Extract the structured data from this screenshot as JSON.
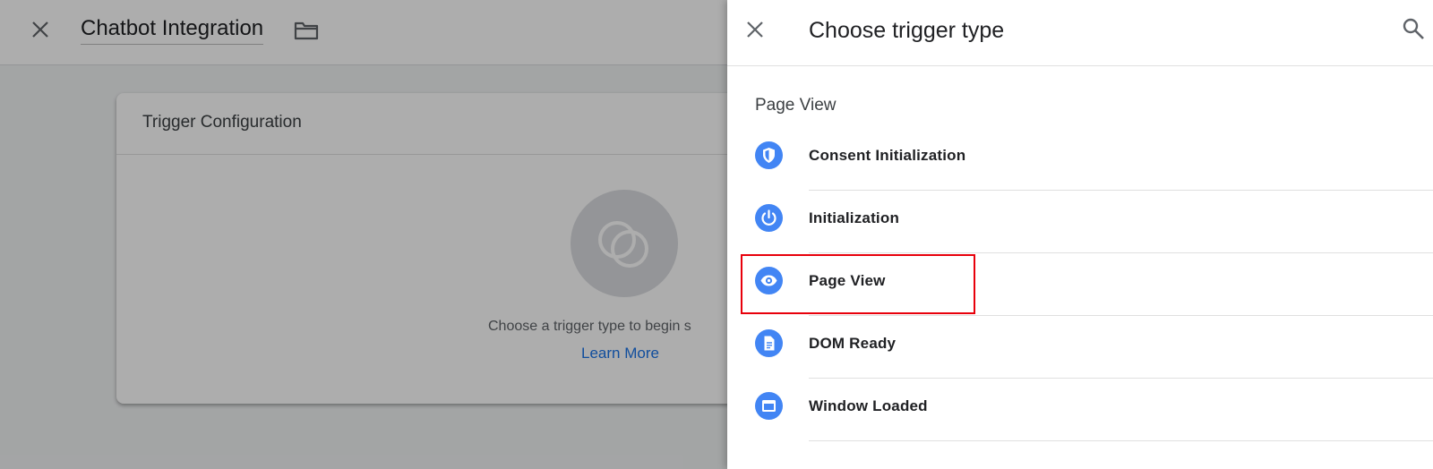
{
  "editor": {
    "title": "Chatbot Integration",
    "card_title": "Trigger Configuration",
    "hint_text": "Choose a trigger type to begin s",
    "learn_more": "Learn More"
  },
  "panel": {
    "title": "Choose trigger type",
    "section": "Page View",
    "items": [
      {
        "label": "Consent Initialization",
        "icon": "shield-icon"
      },
      {
        "label": "Initialization",
        "icon": "power-icon"
      },
      {
        "label": "Page View",
        "icon": "eye-icon"
      },
      {
        "label": "DOM Ready",
        "icon": "document-icon"
      },
      {
        "label": "Window Loaded",
        "icon": "window-icon"
      }
    ]
  },
  "colors": {
    "accent": "#4285f4",
    "link": "#1a73e8",
    "highlight": "#e8000b"
  }
}
